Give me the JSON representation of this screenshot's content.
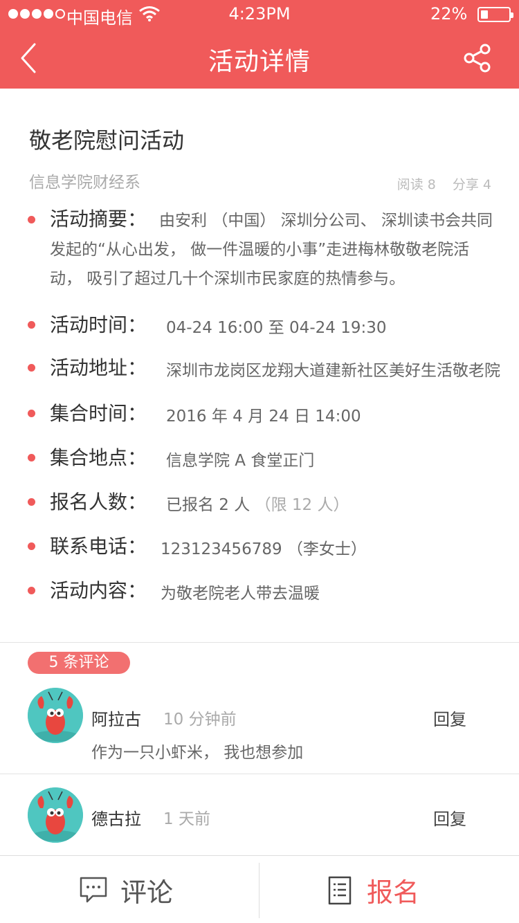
{
  "status_bar": {
    "carrier": "中国电信",
    "time": "4:23PM",
    "battery": "22%"
  },
  "nav": {
    "title": "活动详情",
    "back_icon": "chevron-left-icon",
    "share_icon": "share-icon"
  },
  "event": {
    "title": "敬老院慰问活动",
    "organizer": "信息学院财经系",
    "reads": "阅读 8",
    "shares": "分享 4",
    "summary_label": "活动摘要：",
    "summary": "由安利 （中国） 深圳分公司、 深圳读书会共同发起的“从心出发， 做一件温暖的小事”走进梅林敬敬老院活动， 吸引了超过几十个深圳市民家庭的热情参与。",
    "fields": [
      {
        "label": "活动时间：",
        "value": "04-24  16:00 至 04-24  19:30"
      },
      {
        "label": "活动地址：",
        "value": "深圳市龙岗区龙翔大道建新社区美好生活敬老院"
      },
      {
        "label": "集合时间：",
        "value": "2016 年 4 月 24 日 14:00"
      },
      {
        "label": "集合地点：",
        "value": "信息学院 A 食堂正门"
      },
      {
        "label": "报名人数：",
        "value": "已报名 2 人",
        "extra": "（限 12 人）"
      },
      {
        "label": "联系电话：",
        "value": "123123456789 （李女士）"
      },
      {
        "label": "活动内容：",
        "value": "为敬老院老人带去温暖"
      }
    ]
  },
  "comments": {
    "count_label": "5 条评论",
    "items": [
      {
        "name": "阿拉古",
        "time": "10 分钟前",
        "reply": "回复",
        "text": "作为一只小虾米， 我也想参加"
      },
      {
        "name": "德古拉",
        "time": "1 天前",
        "reply": "回复",
        "text": ""
      }
    ]
  },
  "bottom_bar": {
    "comment_label": "评论",
    "signup_label": "报名",
    "comment_icon": "chat-bubble-icon",
    "signup_icon": "list-document-icon",
    "signup_color": "#f05a5a"
  },
  "colors": {
    "accent": "#f05a5a"
  }
}
